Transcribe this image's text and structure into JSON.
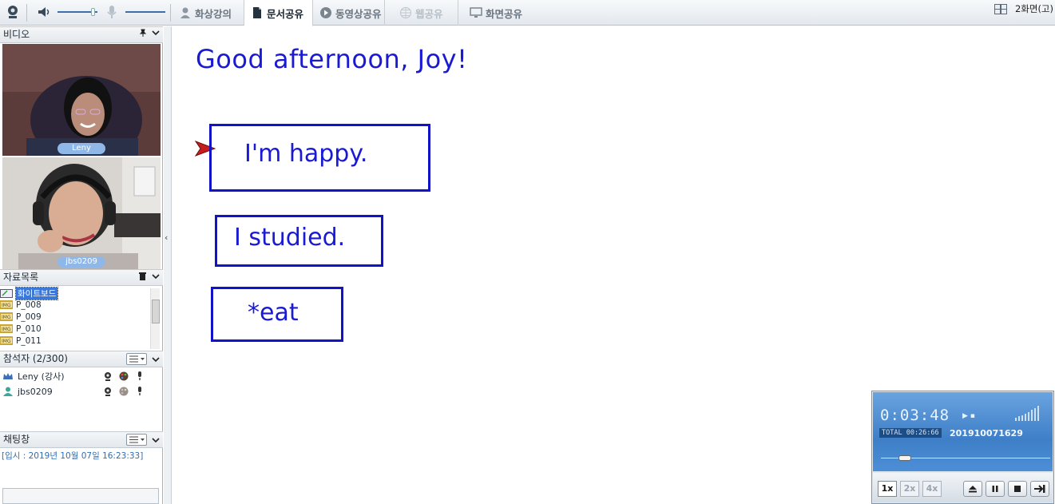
{
  "toolbar": {
    "tabs": [
      {
        "label": "화상강의",
        "icon": "person-icon",
        "state": "normal"
      },
      {
        "label": "문서공유",
        "icon": "document-icon",
        "state": "active"
      },
      {
        "label": "동영상공유",
        "icon": "play-circle-icon",
        "state": "normal"
      },
      {
        "label": "웹공유",
        "icon": "globe-icon",
        "state": "disabled"
      },
      {
        "label": "화면공유",
        "icon": "monitor-icon",
        "state": "normal"
      }
    ],
    "screen_mode": "2화면(고)",
    "volume_level": 0.85,
    "mic_level": 0.0
  },
  "video_panel": {
    "title": "비디오",
    "feeds": [
      {
        "name": "Leny"
      },
      {
        "name": "jbs0209"
      }
    ]
  },
  "files_panel": {
    "title": "자료목록",
    "items": [
      {
        "label": "화이트보드",
        "selected": true,
        "icon": "whiteboard-icon"
      },
      {
        "label": "P_008",
        "selected": false,
        "icon": "image-file-icon"
      },
      {
        "label": "P_009",
        "selected": false,
        "icon": "image-file-icon"
      },
      {
        "label": "P_010",
        "selected": false,
        "icon": "image-file-icon"
      },
      {
        "label": "P_011",
        "selected": false,
        "icon": "image-file-icon"
      }
    ]
  },
  "participants_panel": {
    "title": "참석자 (2/300)",
    "users": [
      {
        "name": "Leny (강사)",
        "role": "teacher",
        "icon": "crown-icon"
      },
      {
        "name": "jbs0209",
        "role": "student",
        "icon": "user-icon"
      }
    ]
  },
  "chat_panel": {
    "title": "채팅창",
    "messages": [
      "[입시 : 2019년 10월 07일 16:23:33]"
    ]
  },
  "document": {
    "greeting": "Good afternoon, Joy!",
    "boxes": [
      "I'm happy.",
      "I studied.",
      "*eat"
    ]
  },
  "player": {
    "current_time": "0:03:48",
    "total_label": "TOTAL 00:26:66",
    "recording_id": "201910071629",
    "progress": 0.14,
    "speeds": [
      "1x",
      "2x",
      "4x"
    ],
    "active_speed": "1x"
  },
  "colors": {
    "accent": "#1a1ad4",
    "selection": "#3b78d8",
    "player_blue": "#4d8fd6"
  }
}
